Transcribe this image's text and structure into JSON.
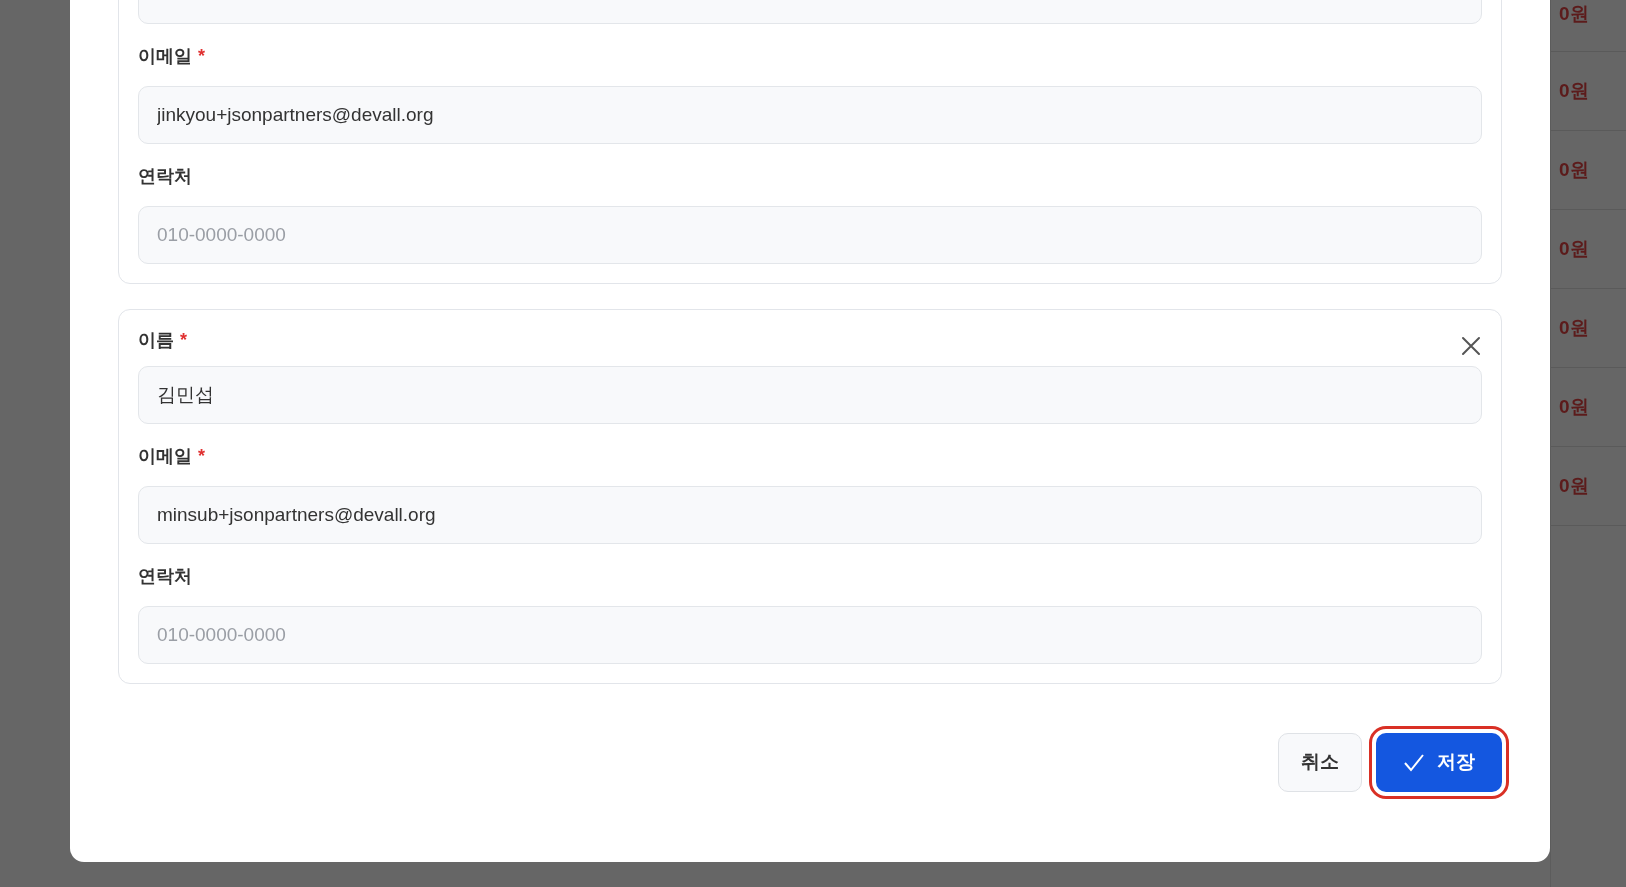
{
  "background_rows": [
    {
      "amount": "0원"
    },
    {
      "amount": "0원"
    },
    {
      "amount": "0원"
    },
    {
      "amount": "0원"
    },
    {
      "amount": "0원"
    },
    {
      "amount": "0원"
    },
    {
      "amount": "0원"
    }
  ],
  "contacts": [
    {
      "fields": [
        {
          "kind": "cut"
        },
        {
          "kind": "text",
          "label": "이메일",
          "required_mark": "*",
          "value": "jinkyou+jsonpartners@devall.org"
        },
        {
          "kind": "text",
          "label": "연락처",
          "placeholder": "010-0000-0000"
        }
      ]
    },
    {
      "removable": true,
      "fields": [
        {
          "kind": "text",
          "label": "이름",
          "required_mark": "*",
          "value": "김민섭"
        },
        {
          "kind": "text",
          "label": "이메일",
          "required_mark": "*",
          "value": "minsub+jsonpartners@devall.org"
        },
        {
          "kind": "text",
          "label": "연락처",
          "placeholder": "010-0000-0000"
        }
      ]
    }
  ],
  "buttons": [
    {
      "kind": "cancel",
      "label": "취소",
      "highlighted": false
    },
    {
      "kind": "save",
      "label": "저장",
      "highlighted": true
    }
  ]
}
